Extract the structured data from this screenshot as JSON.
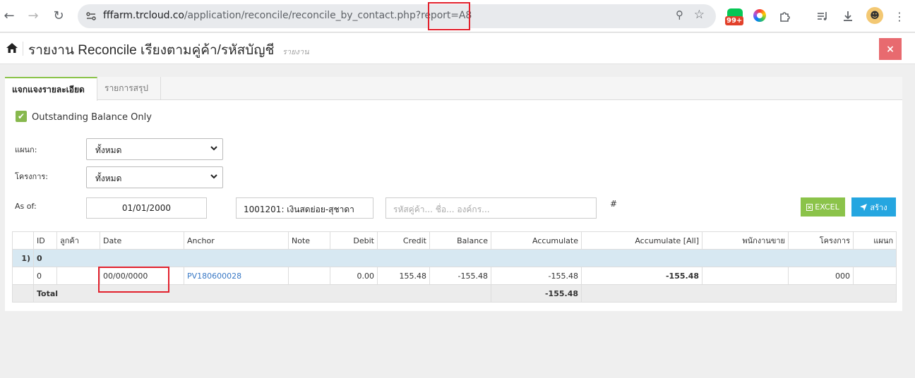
{
  "browser": {
    "url_host": "fffarm.trcloud.co",
    "url_path": "/application/reconcile/reconcile_by_contact.php?report=A8",
    "extension_badge": "99+"
  },
  "header": {
    "title": "รายงาน Reconcile เรียงตามคู่ค้า/รหัสบัญชี",
    "subtitle": "รายงาน",
    "close": "×"
  },
  "tabs": [
    {
      "label": "แจกแจงรายละเอียด"
    },
    {
      "label": "รายการสรุป"
    }
  ],
  "filters": {
    "outstanding_label": "Outstanding Balance Only",
    "department_label": "แผนก:",
    "department_value": "ทั้งหมด",
    "project_label": "โครงการ:",
    "project_value": "ทั้งหมด",
    "asof_label": "As of:",
    "asof_value": "01/01/2000",
    "account_value": "1001201: เงินสดย่อย-สุชาดา",
    "contact_placeholder": "รหัสคู่ค้า... ชื่อ... องค์กร...",
    "hash": "#"
  },
  "buttons": {
    "excel": "EXCEL",
    "create": "สร้าง"
  },
  "table": {
    "headers": [
      "",
      "ID",
      "ลูกค้า",
      "Date",
      "Anchor",
      "Note",
      "Debit",
      "Credit",
      "Balance",
      "Accumulate",
      "Accumulate [All]",
      "พนักงานขาย",
      "โครงการ",
      "แผนก"
    ],
    "group": {
      "index": "1)",
      "id": "0"
    },
    "row": {
      "id": "0",
      "customer": "",
      "date": "00/00/0000",
      "anchor": "PV180600028",
      "note": "",
      "debit": "0.00",
      "credit": "155.48",
      "balance": "-155.48",
      "accumulate": "-155.48",
      "accumulate_all": "-155.48",
      "salesperson": "",
      "project": "000",
      "department": ""
    },
    "total": {
      "label": "Total",
      "accumulate": "-155.48"
    }
  },
  "colors": {
    "accent_green": "#8bc34a",
    "accent_blue": "#25a6e0",
    "close_red": "#e86a6f",
    "annotation_red": "#e2212d"
  }
}
